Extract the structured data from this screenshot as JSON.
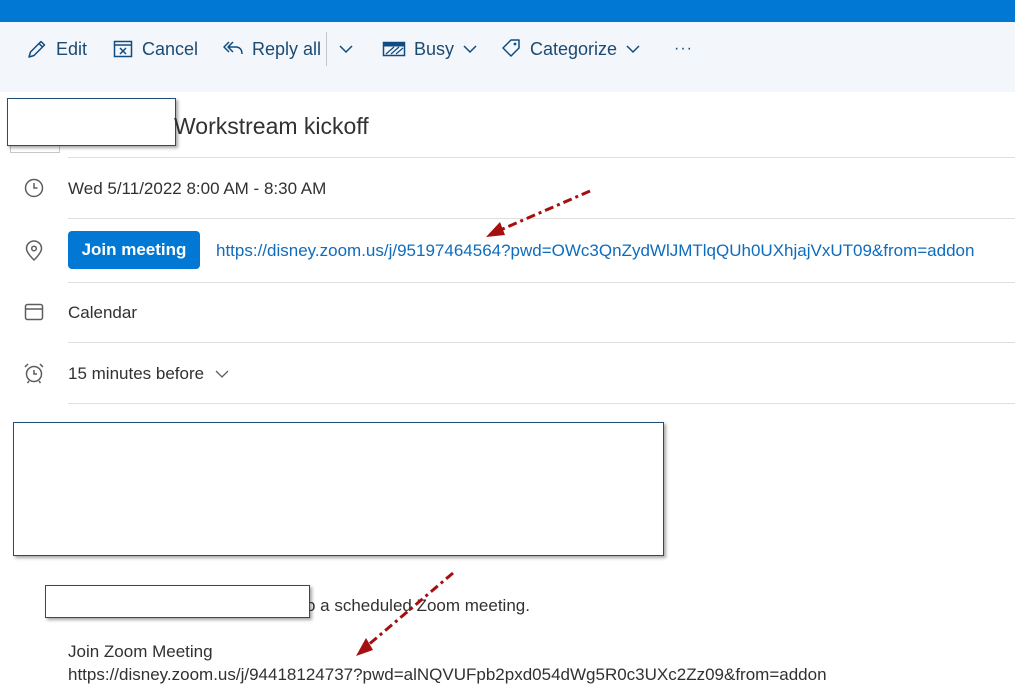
{
  "toolbar": {
    "edit": "Edit",
    "cancel": "Cancel",
    "reply_all": "Reply all",
    "busy": "Busy",
    "categorize": "Categorize",
    "more": "···"
  },
  "event": {
    "title": "Workstream kickoff",
    "datetime": "Wed 5/11/2022 8:00 AM - 8:30 AM",
    "join_label": "Join meeting",
    "link": "https://disney.zoom.us/j/95197464564?pwd=OWc3QnZydWlJMTlqQUh0UXhjajVxUT09&from=addon",
    "calendar": "Calendar",
    "reminder": "15 minutes before"
  },
  "body": {
    "invite_fragment": "o a scheduled Zoom meeting.",
    "join_heading": "Join Zoom Meeting",
    "join_link": "https://disney.zoom.us/j/94418124737?pwd=alNQVUFpb2pxd054dWg5R0c3UXc2Zz09&from=addon"
  },
  "colors": {
    "accent": "#0078d4",
    "link": "#0f6cbd",
    "arrow": "#a50f0f"
  }
}
